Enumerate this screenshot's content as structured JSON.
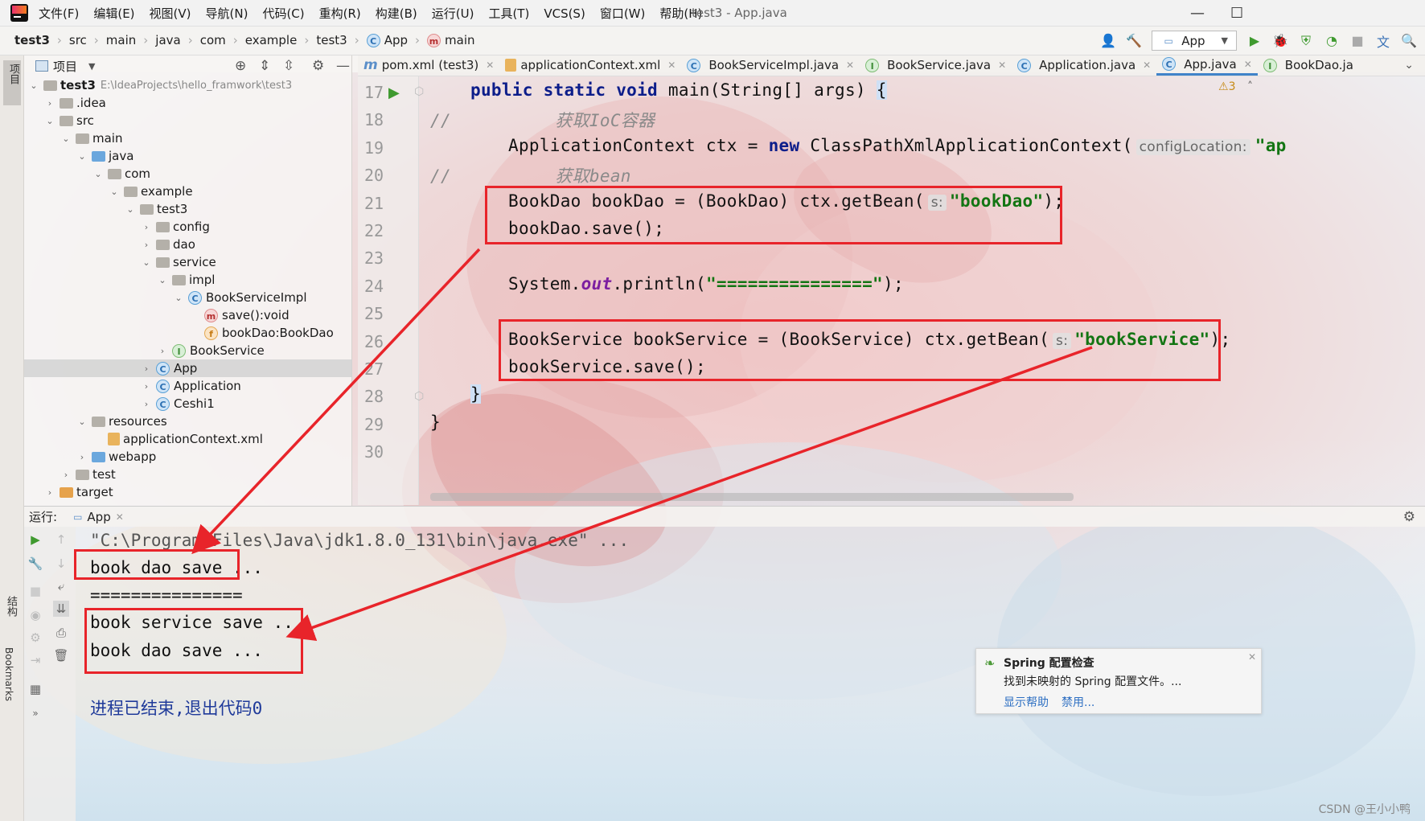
{
  "menubar": {
    "items": [
      "文件(F)",
      "编辑(E)",
      "视图(V)",
      "导航(N)",
      "代码(C)",
      "重构(R)",
      "构建(B)",
      "运行(U)",
      "工具(T)",
      "VCS(S)",
      "窗口(W)",
      "帮助(H)"
    ],
    "window_title": "test3 - App.java",
    "minimize_icon": "—",
    "maximize_icon": "☐"
  },
  "breadcrumb": {
    "items": [
      "test3",
      "src",
      "main",
      "java",
      "com",
      "example",
      "test3",
      "App",
      "main"
    ],
    "run_config": "App"
  },
  "left_strip": {
    "project_label": "项目",
    "structure_label": "结构",
    "bookmarks_label": "Bookmarks"
  },
  "project_panel": {
    "title": "项目",
    "root_name": "test3",
    "root_path": "E:\\IdeaProjects\\hello_framwork\\test3",
    "tree": [
      {
        "label": "test3",
        "depth": 0,
        "arrow": "open",
        "icon": "folder-gray",
        "path": "E:\\IdeaProjects\\hello_framwork\\test3"
      },
      {
        "label": ".idea",
        "depth": 1,
        "arrow": "closed",
        "icon": "folder-gray"
      },
      {
        "label": "src",
        "depth": 1,
        "arrow": "open",
        "icon": "folder-gray"
      },
      {
        "label": "main",
        "depth": 2,
        "arrow": "open",
        "icon": "folder-gray"
      },
      {
        "label": "java",
        "depth": 3,
        "arrow": "open",
        "icon": "folder-blue"
      },
      {
        "label": "com",
        "depth": 4,
        "arrow": "open",
        "icon": "folder-gray"
      },
      {
        "label": "example",
        "depth": 5,
        "arrow": "open",
        "icon": "folder-gray"
      },
      {
        "label": "test3",
        "depth": 6,
        "arrow": "open",
        "icon": "folder-gray"
      },
      {
        "label": "config",
        "depth": 7,
        "arrow": "closed",
        "icon": "folder-gray"
      },
      {
        "label": "dao",
        "depth": 7,
        "arrow": "closed",
        "icon": "folder-gray"
      },
      {
        "label": "service",
        "depth": 7,
        "arrow": "open",
        "icon": "folder-gray"
      },
      {
        "label": "impl",
        "depth": 8,
        "arrow": "open",
        "icon": "folder-gray"
      },
      {
        "label": "BookServiceImpl",
        "depth": 9,
        "arrow": "open",
        "icon": "class-c"
      },
      {
        "label": "save():void",
        "depth": 10,
        "arrow": "none",
        "icon": "method-m"
      },
      {
        "label": "bookDao:BookDao",
        "depth": 10,
        "arrow": "none",
        "icon": "field-f"
      },
      {
        "label": "BookService",
        "depth": 8,
        "arrow": "closed",
        "icon": "interface-i"
      },
      {
        "label": "App",
        "depth": 7,
        "arrow": "closed",
        "icon": "class-c",
        "selected": true
      },
      {
        "label": "Application",
        "depth": 7,
        "arrow": "closed",
        "icon": "class-c"
      },
      {
        "label": "Ceshi1",
        "depth": 7,
        "arrow": "closed",
        "icon": "class-c"
      },
      {
        "label": "resources",
        "depth": 3,
        "arrow": "open",
        "icon": "folder-gray"
      },
      {
        "label": "applicationContext.xml",
        "depth": 4,
        "arrow": "none",
        "icon": "xml"
      },
      {
        "label": "webapp",
        "depth": 3,
        "arrow": "closed",
        "icon": "folder-blue"
      },
      {
        "label": "test",
        "depth": 2,
        "arrow": "closed",
        "icon": "folder-gray"
      },
      {
        "label": "target",
        "depth": 1,
        "arrow": "closed",
        "icon": "folder-orange"
      }
    ]
  },
  "editor_tabs": [
    {
      "label": "pom.xml (test3)",
      "icon": "maven-m"
    },
    {
      "label": "applicationContext.xml",
      "icon": "xml"
    },
    {
      "label": "BookServiceImpl.java",
      "icon": "class-c"
    },
    {
      "label": "BookService.java",
      "icon": "interface-i"
    },
    {
      "label": "Application.java",
      "icon": "class-c"
    },
    {
      "label": "App.java",
      "icon": "class-c",
      "active": true
    },
    {
      "label": "BookDao.ja",
      "icon": "interface-i"
    }
  ],
  "editor": {
    "warning_count": "3",
    "line_numbers": [
      "17",
      "18",
      "19",
      "20",
      "21",
      "22",
      "23",
      "24",
      "25",
      "26",
      "27",
      "28",
      "29",
      "30"
    ],
    "lines": {
      "l17": {
        "kw": "public static void",
        "rest": " main(String[] args) ",
        "brace": "{"
      },
      "l18": {
        "slashes": "//",
        "comment": "获取IoC容器"
      },
      "l19": {
        "a": "ApplicationContext ctx = ",
        "kw": "new",
        "b": " ClassPathXmlApplicationContext(",
        "hint": "configLocation:",
        "str": "\"ap"
      },
      "l20": {
        "slashes": "//",
        "comment": "获取bean"
      },
      "l21": {
        "a": "BookDao bookDao = (BookDao) ctx.getBean(",
        "hint": "s:",
        "str": "\"bookDao\"",
        "b": ");"
      },
      "l22": {
        "a": "bookDao.save();"
      },
      "l24": {
        "a": "System.",
        "fld": "out",
        "b": ".println(",
        "str": "\"===============\"",
        "c": ");"
      },
      "l26": {
        "a": "BookService bookService = (BookService) ctx.getBean(",
        "hint": "s:",
        "str": "\"bookService\"",
        "b": ");"
      },
      "l27": {
        "a": "bookService.save();"
      },
      "l28": {
        "brace": "}"
      },
      "l29": {
        "brace": "}"
      }
    }
  },
  "run_panel": {
    "label": "运行:",
    "tab": "App",
    "output": [
      "\"C:\\Program Files\\Java\\jdk1.8.0_131\\bin\\java.exe\" ...",
      "book dao save ...",
      "===============",
      "book service save ...",
      "book dao save ...",
      "进程已结束,退出代码0"
    ]
  },
  "notification": {
    "title": "Spring 配置检查",
    "body": "找到未映射的 Spring 配置文件。...",
    "action_help": "显示帮助",
    "action_disable": "禁用..."
  },
  "watermark": "CSDN @王小小鸭",
  "colors": {
    "annotation_red": "#e8242a",
    "keyword": "#0c1d8a",
    "string": "#137513",
    "accent": "#4083c9"
  }
}
